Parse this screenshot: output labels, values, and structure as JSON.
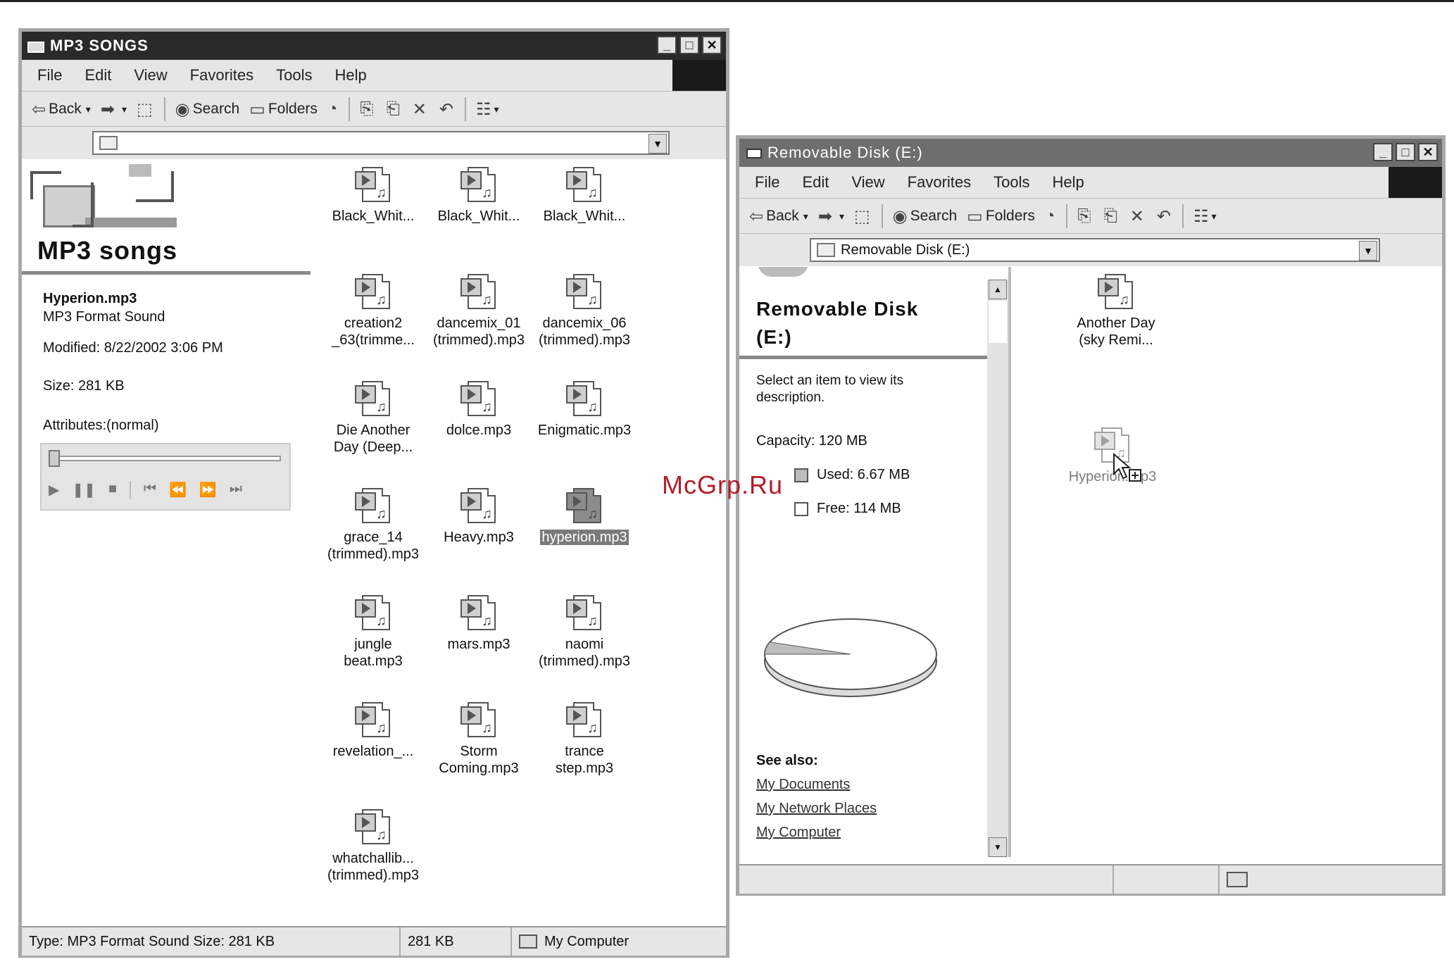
{
  "watermark": "McGrp.Ru",
  "left_window": {
    "title": "MP3 SONGS",
    "menu": [
      "File",
      "Edit",
      "View",
      "Favorites",
      "Tools",
      "Help"
    ],
    "toolbar": {
      "back": "Back",
      "search": "Search",
      "folders": "Folders"
    },
    "panel": {
      "heading": "MP3 songs",
      "file_name": "Hyperion.mp3",
      "file_type": "MP3 Format Sound",
      "modified": "Modified: 8/22/2002 3:06 PM",
      "size": "Size: 281 KB",
      "attributes": "Attributes:(normal)"
    },
    "files": [
      [
        "Black_Whit...",
        ""
      ],
      [
        "Black_Whit...",
        ""
      ],
      [
        "Black_Whit...",
        ""
      ],
      [
        "creation2",
        "_63(trimme..."
      ],
      [
        "dancemix_01",
        "(trimmed).mp3"
      ],
      [
        "dancemix_06",
        "(trimmed).mp3"
      ],
      [
        "Die Another",
        "Day (Deep..."
      ],
      [
        "dolce.mp3",
        ""
      ],
      [
        "Enigmatic.mp3",
        ""
      ],
      [
        "grace_14",
        "(trimmed).mp3"
      ],
      [
        "Heavy.mp3",
        ""
      ],
      [
        "hyperion.mp3",
        ""
      ],
      [
        "jungle",
        "beat.mp3"
      ],
      [
        "mars.mp3",
        ""
      ],
      [
        "naomi",
        "(trimmed).mp3"
      ],
      [
        "revelation_...",
        ""
      ],
      [
        "Storm",
        "Coming.mp3"
      ],
      [
        "trance",
        "step.mp3"
      ],
      [
        "whatchallib...",
        "(trimmed).mp3"
      ]
    ],
    "selected_index": 11,
    "status": {
      "type": "Type: MP3 Format Sound Size: 281 KB",
      "size": "281 KB",
      "zone": "My Computer"
    }
  },
  "right_window": {
    "title": "Removable Disk (E:)",
    "menu": [
      "File",
      "Edit",
      "View",
      "Favorites",
      "Tools",
      "Help"
    ],
    "toolbar": {
      "back": "Back",
      "search": "Search",
      "folders": "Folders"
    },
    "address": "Removable Disk (E:)",
    "panel": {
      "heading_line1": "Removable Disk",
      "heading_line2": "(E:)",
      "select_hint": "Select an item to view its description.",
      "capacity": "Capacity: 120 MB",
      "used": "Used: 6.67 MB",
      "free": "Free: 114 MB",
      "see_also": "See also:",
      "links": [
        "My Documents",
        "My Network Places",
        "My Computer"
      ]
    },
    "disk_usage_fraction": 0.056,
    "files": [
      [
        "Another Day",
        "(sky Remi..."
      ]
    ],
    "drag_item": "Hyperion.mp3"
  }
}
